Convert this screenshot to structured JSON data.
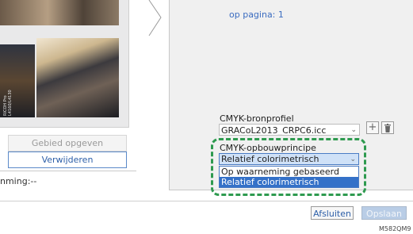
{
  "preview": {
    "sheet_text": "RICOH Pro\nL4160/L4130"
  },
  "left": {
    "define_area_label": "Gebied opgeven",
    "delete_label": "Verwijderen",
    "status_text": "nming:--"
  },
  "right": {
    "page_ref": "op pagina: 1",
    "source_profile_label": "CMYK-bronprofiel",
    "source_profile_value": "GRACoL2013_CRPC6.icc",
    "build_principle_label": "CMYK-opbouwprincipe",
    "build_principle_value": "Relatief colorimetrisch",
    "options": [
      "Op waarneming gebaseerd",
      "Relatief colorimetrisch"
    ]
  },
  "footer": {
    "close_label": "Afsluiten",
    "save_label": "Opslaan",
    "figure_code": "M582QM9"
  },
  "colors": {
    "accent": "#3471c8",
    "highlight_border": "#2e9a4f",
    "link": "#3b6cc0"
  }
}
